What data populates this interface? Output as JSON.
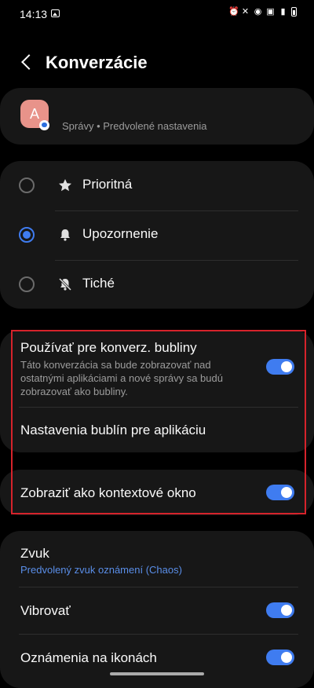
{
  "status_bar": {
    "time": "14:13"
  },
  "header": {
    "title": "Konverzácie"
  },
  "app_card": {
    "avatar_letter": "A",
    "subtitle": "Správy • Predvolené nastavenia"
  },
  "importance": {
    "options": [
      {
        "label": "Prioritná",
        "icon": "star-icon",
        "selected": false
      },
      {
        "label": "Upozornenie",
        "icon": "bell-icon",
        "selected": true
      },
      {
        "label": "Tiché",
        "icon": "bell-off-icon",
        "selected": false
      }
    ]
  },
  "bubbles": {
    "use_title": "Používať pre konverz. bubliny",
    "use_desc_line1": "Táto konverzácia sa bude zobrazovať nad",
    "use_desc_line2": "ostatnými aplikáciami a nové správy sa budú",
    "use_desc_line3": "zobrazovať ako bubliny.",
    "use_enabled": true,
    "app_settings": "Nastavenia bublín pre aplikáciu"
  },
  "popup": {
    "label": "Zobraziť ako kontextové okno",
    "enabled": true
  },
  "sound": {
    "title": "Zvuk",
    "value": "Predvolený zvuk oznámení (Chaos)",
    "vibrate": "Vibrovať",
    "vibrate_enabled": true,
    "icon_badges": "Oznámenia na ikonách",
    "icon_badges_enabled": true
  },
  "colors": {
    "accent": "#3f7cf0",
    "highlight": "#d6232b",
    "card_bg": "#171717"
  }
}
